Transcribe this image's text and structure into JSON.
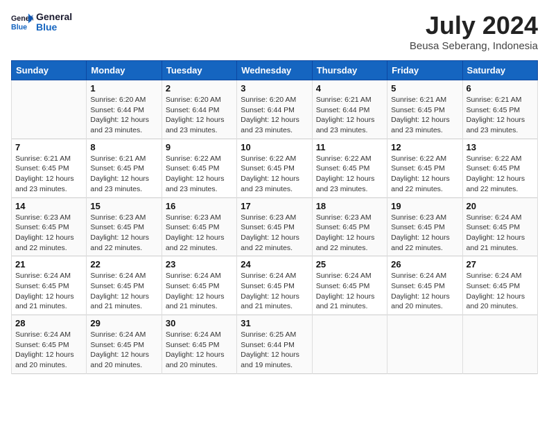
{
  "header": {
    "logo_line1": "General",
    "logo_line2": "Blue",
    "month": "July 2024",
    "location": "Beusa Seberang, Indonesia"
  },
  "columns": [
    "Sunday",
    "Monday",
    "Tuesday",
    "Wednesday",
    "Thursday",
    "Friday",
    "Saturday"
  ],
  "weeks": [
    [
      {
        "day": "",
        "sunrise": "",
        "sunset": "",
        "daylight": ""
      },
      {
        "day": "1",
        "sunrise": "Sunrise: 6:20 AM",
        "sunset": "Sunset: 6:44 PM",
        "daylight": "Daylight: 12 hours and 23 minutes."
      },
      {
        "day": "2",
        "sunrise": "Sunrise: 6:20 AM",
        "sunset": "Sunset: 6:44 PM",
        "daylight": "Daylight: 12 hours and 23 minutes."
      },
      {
        "day": "3",
        "sunrise": "Sunrise: 6:20 AM",
        "sunset": "Sunset: 6:44 PM",
        "daylight": "Daylight: 12 hours and 23 minutes."
      },
      {
        "day": "4",
        "sunrise": "Sunrise: 6:21 AM",
        "sunset": "Sunset: 6:44 PM",
        "daylight": "Daylight: 12 hours and 23 minutes."
      },
      {
        "day": "5",
        "sunrise": "Sunrise: 6:21 AM",
        "sunset": "Sunset: 6:45 PM",
        "daylight": "Daylight: 12 hours and 23 minutes."
      },
      {
        "day": "6",
        "sunrise": "Sunrise: 6:21 AM",
        "sunset": "Sunset: 6:45 PM",
        "daylight": "Daylight: 12 hours and 23 minutes."
      }
    ],
    [
      {
        "day": "7",
        "sunrise": "Sunrise: 6:21 AM",
        "sunset": "Sunset: 6:45 PM",
        "daylight": "Daylight: 12 hours and 23 minutes."
      },
      {
        "day": "8",
        "sunrise": "Sunrise: 6:21 AM",
        "sunset": "Sunset: 6:45 PM",
        "daylight": "Daylight: 12 hours and 23 minutes."
      },
      {
        "day": "9",
        "sunrise": "Sunrise: 6:22 AM",
        "sunset": "Sunset: 6:45 PM",
        "daylight": "Daylight: 12 hours and 23 minutes."
      },
      {
        "day": "10",
        "sunrise": "Sunrise: 6:22 AM",
        "sunset": "Sunset: 6:45 PM",
        "daylight": "Daylight: 12 hours and 23 minutes."
      },
      {
        "day": "11",
        "sunrise": "Sunrise: 6:22 AM",
        "sunset": "Sunset: 6:45 PM",
        "daylight": "Daylight: 12 hours and 23 minutes."
      },
      {
        "day": "12",
        "sunrise": "Sunrise: 6:22 AM",
        "sunset": "Sunset: 6:45 PM",
        "daylight": "Daylight: 12 hours and 22 minutes."
      },
      {
        "day": "13",
        "sunrise": "Sunrise: 6:22 AM",
        "sunset": "Sunset: 6:45 PM",
        "daylight": "Daylight: 12 hours and 22 minutes."
      }
    ],
    [
      {
        "day": "14",
        "sunrise": "Sunrise: 6:23 AM",
        "sunset": "Sunset: 6:45 PM",
        "daylight": "Daylight: 12 hours and 22 minutes."
      },
      {
        "day": "15",
        "sunrise": "Sunrise: 6:23 AM",
        "sunset": "Sunset: 6:45 PM",
        "daylight": "Daylight: 12 hours and 22 minutes."
      },
      {
        "day": "16",
        "sunrise": "Sunrise: 6:23 AM",
        "sunset": "Sunset: 6:45 PM",
        "daylight": "Daylight: 12 hours and 22 minutes."
      },
      {
        "day": "17",
        "sunrise": "Sunrise: 6:23 AM",
        "sunset": "Sunset: 6:45 PM",
        "daylight": "Daylight: 12 hours and 22 minutes."
      },
      {
        "day": "18",
        "sunrise": "Sunrise: 6:23 AM",
        "sunset": "Sunset: 6:45 PM",
        "daylight": "Daylight: 12 hours and 22 minutes."
      },
      {
        "day": "19",
        "sunrise": "Sunrise: 6:23 AM",
        "sunset": "Sunset: 6:45 PM",
        "daylight": "Daylight: 12 hours and 22 minutes."
      },
      {
        "day": "20",
        "sunrise": "Sunrise: 6:24 AM",
        "sunset": "Sunset: 6:45 PM",
        "daylight": "Daylight: 12 hours and 21 minutes."
      }
    ],
    [
      {
        "day": "21",
        "sunrise": "Sunrise: 6:24 AM",
        "sunset": "Sunset: 6:45 PM",
        "daylight": "Daylight: 12 hours and 21 minutes."
      },
      {
        "day": "22",
        "sunrise": "Sunrise: 6:24 AM",
        "sunset": "Sunset: 6:45 PM",
        "daylight": "Daylight: 12 hours and 21 minutes."
      },
      {
        "day": "23",
        "sunrise": "Sunrise: 6:24 AM",
        "sunset": "Sunset: 6:45 PM",
        "daylight": "Daylight: 12 hours and 21 minutes."
      },
      {
        "day": "24",
        "sunrise": "Sunrise: 6:24 AM",
        "sunset": "Sunset: 6:45 PM",
        "daylight": "Daylight: 12 hours and 21 minutes."
      },
      {
        "day": "25",
        "sunrise": "Sunrise: 6:24 AM",
        "sunset": "Sunset: 6:45 PM",
        "daylight": "Daylight: 12 hours and 21 minutes."
      },
      {
        "day": "26",
        "sunrise": "Sunrise: 6:24 AM",
        "sunset": "Sunset: 6:45 PM",
        "daylight": "Daylight: 12 hours and 20 minutes."
      },
      {
        "day": "27",
        "sunrise": "Sunrise: 6:24 AM",
        "sunset": "Sunset: 6:45 PM",
        "daylight": "Daylight: 12 hours and 20 minutes."
      }
    ],
    [
      {
        "day": "28",
        "sunrise": "Sunrise: 6:24 AM",
        "sunset": "Sunset: 6:45 PM",
        "daylight": "Daylight: 12 hours and 20 minutes."
      },
      {
        "day": "29",
        "sunrise": "Sunrise: 6:24 AM",
        "sunset": "Sunset: 6:45 PM",
        "daylight": "Daylight: 12 hours and 20 minutes."
      },
      {
        "day": "30",
        "sunrise": "Sunrise: 6:24 AM",
        "sunset": "Sunset: 6:45 PM",
        "daylight": "Daylight: 12 hours and 20 minutes."
      },
      {
        "day": "31",
        "sunrise": "Sunrise: 6:25 AM",
        "sunset": "Sunset: 6:44 PM",
        "daylight": "Daylight: 12 hours and 19 minutes."
      },
      {
        "day": "",
        "sunrise": "",
        "sunset": "",
        "daylight": ""
      },
      {
        "day": "",
        "sunrise": "",
        "sunset": "",
        "daylight": ""
      },
      {
        "day": "",
        "sunrise": "",
        "sunset": "",
        "daylight": ""
      }
    ]
  ]
}
